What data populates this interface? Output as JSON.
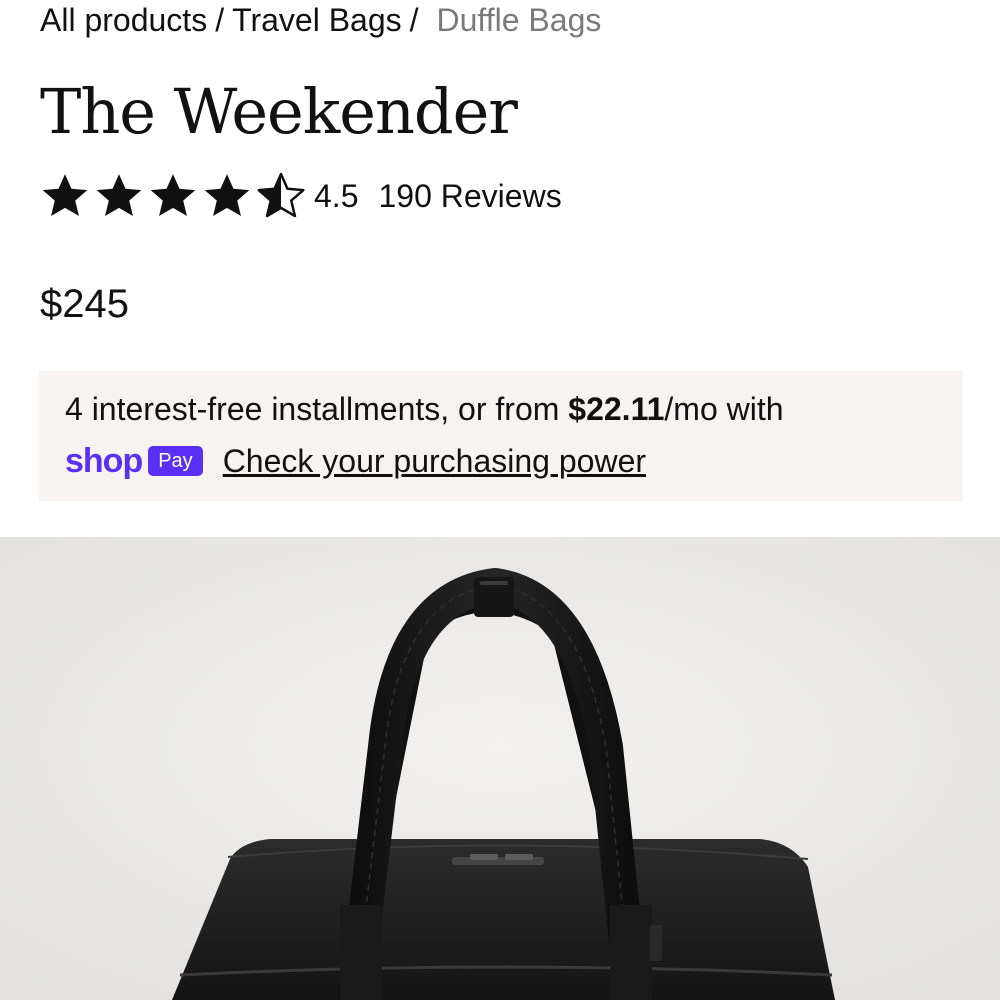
{
  "breadcrumb": {
    "items": [
      "All products",
      "Travel Bags"
    ],
    "current": "Duffle Bags",
    "separator": "/"
  },
  "product": {
    "title": "The Weekender",
    "rating": 4.5,
    "rating_text": "4.5",
    "reviews_text": "190 Reviews",
    "price": "$245",
    "image_name": "weekender-duffle-bag-black"
  },
  "installments": {
    "prefix": "4 interest-free installments, or from ",
    "amount": "$22.11",
    "suffix": "/mo with",
    "shop_word": "shop",
    "pay_badge": "Pay",
    "link_text": "Check your purchasing power"
  },
  "colors": {
    "text": "#111111",
    "muted": "#7a7a7a",
    "shop_pay": "#5a31f4",
    "installment_bg": "#f6f3f0",
    "image_bg": "#e9e8e6"
  },
  "icons": [
    "star-full-icon",
    "star-half-icon"
  ]
}
